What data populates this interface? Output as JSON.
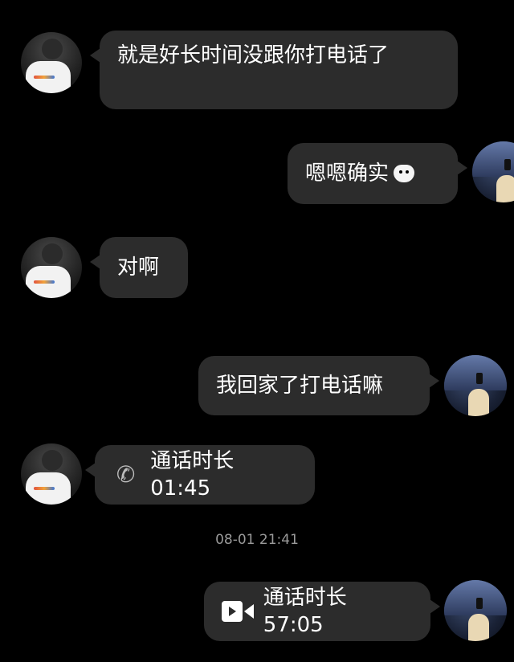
{
  "messages": [
    {
      "side": "left",
      "text": "就是好长时间没跟你打电话了"
    },
    {
      "side": "right",
      "text": "嗯嗯确实",
      "emoji": "bear-face-emoji"
    },
    {
      "side": "left",
      "text": "对啊"
    },
    {
      "side": "right",
      "text": "我回家了打电话嘛"
    },
    {
      "side": "left",
      "type": "voice-call",
      "icon": "phone-icon",
      "label": "通话时长 01:45"
    },
    {
      "side": "right",
      "type": "video-call",
      "icon": "video-camera-icon",
      "label": "通话时长 57:05"
    }
  ],
  "timestamp": "08-01 21:41",
  "colors": {
    "background": "#000000",
    "bubble": "#2c2c2c",
    "text": "#ffffff",
    "timestamp": "#9a9a9a"
  }
}
